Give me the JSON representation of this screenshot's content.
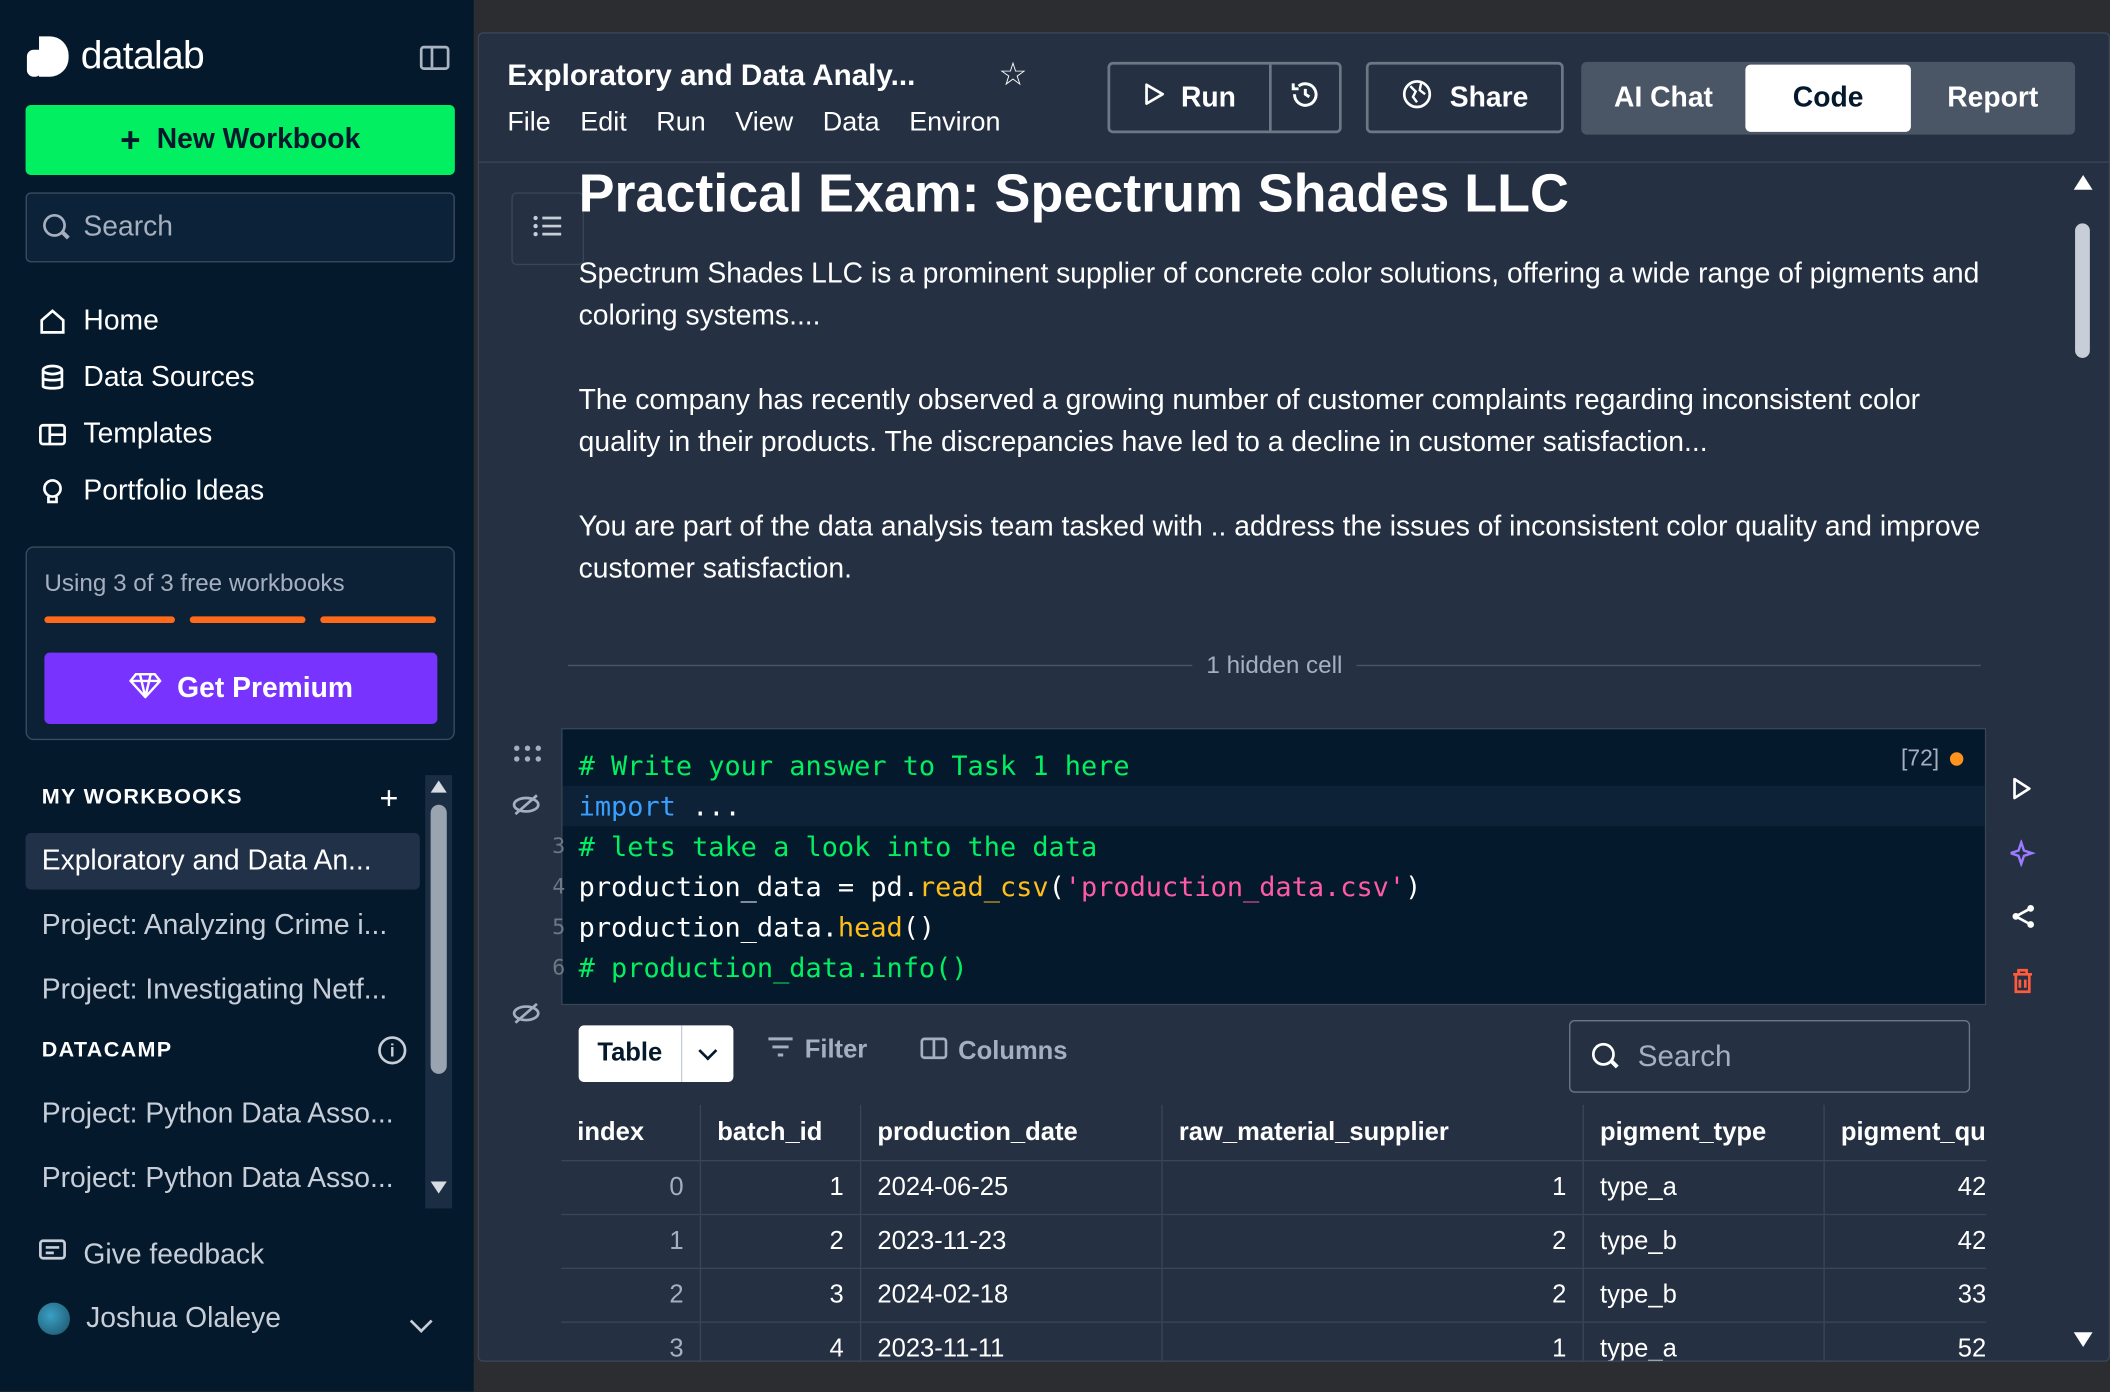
{
  "sidebar": {
    "logo_text": "datalab",
    "new_workbook_label": "New Workbook",
    "search_placeholder": "Search",
    "nav": [
      {
        "label": "Home",
        "icon": "home-icon"
      },
      {
        "label": "Data Sources",
        "icon": "database-icon"
      },
      {
        "label": "Templates",
        "icon": "templates-icon"
      },
      {
        "label": "Portfolio Ideas",
        "icon": "lightbulb-icon"
      }
    ],
    "usage_text": "Using 3 of 3 free workbooks",
    "usage_used": 3,
    "usage_total": 3,
    "premium_label": "Get Premium",
    "my_workbooks_heading": "MY WORKBOOKS",
    "my_workbooks": [
      "Exploratory and Data An...",
      "Project: Analyzing Crime i...",
      "Project: Investigating Netf..."
    ],
    "datacamp_heading": "DATACAMP",
    "datacamp_items": [
      "Project: Python Data Asso...",
      "Project: Python Data Asso..."
    ],
    "feedback_label": "Give feedback",
    "user_name": "Joshua Olaleye"
  },
  "topbar": {
    "workbook_title": "Exploratory and Data Analy...",
    "menus": [
      "File",
      "Edit",
      "Run",
      "View",
      "Data",
      "Environ"
    ],
    "run_label": "Run",
    "share_label": "Share",
    "modes": [
      "AI Chat",
      "Code",
      "Report"
    ],
    "active_mode": "Code"
  },
  "document": {
    "title": "Practical Exam: Spectrum Shades LLC",
    "paragraphs": [
      "Spectrum Shades LLC is a prominent supplier of concrete color solutions, offering a wide range of pigments and coloring systems....",
      "The company has recently observed a growing number of customer complaints regarding inconsistent color quality in their products. The discrepancies have led to a decline in customer satisfaction...",
      "You are part of the data analysis team tasked with .. address the issues of inconsistent color quality and improve customer satisfaction."
    ],
    "hidden_cell_label": "1 hidden cell"
  },
  "code_cell": {
    "exec_count": "[72]",
    "line1": "# Write your answer to Task 1 here",
    "line2_kw": "import",
    "line2_rest": " ...",
    "line3": "# lets take a look into the data",
    "line4_a": "production_data = pd.",
    "line4_fn": "read_csv",
    "line4_b": "(",
    "line4_str": "'production_data.csv'",
    "line4_c": ")",
    "line5_a": "production_data.",
    "line5_fn": "head",
    "line5_b": "()",
    "line6": "# production_data.info()",
    "line_numbers": [
      "3",
      "4",
      "5",
      "6"
    ]
  },
  "output": {
    "view_label": "Table",
    "filter_label": "Filter",
    "columns_label": "Columns",
    "search_placeholder": "Search",
    "headers": [
      "index",
      "batch_id",
      "production_date",
      "raw_material_supplier",
      "pigment_type",
      "pigment_qu"
    ],
    "rows": [
      [
        "0",
        "1",
        "2024-06-25",
        "1",
        "type_a",
        "42"
      ],
      [
        "1",
        "2",
        "2023-11-23",
        "2",
        "type_b",
        "42"
      ],
      [
        "2",
        "3",
        "2024-02-18",
        "2",
        "type_b",
        "33"
      ],
      [
        "3",
        "4",
        "2023-11-11",
        "1",
        "type_a",
        "52"
      ]
    ]
  },
  "colors": {
    "sidebar_bg": "#05192d",
    "accent_green": "#03ef62",
    "premium_purple": "#7933ff",
    "usage_orange": "#ff6a1a"
  }
}
